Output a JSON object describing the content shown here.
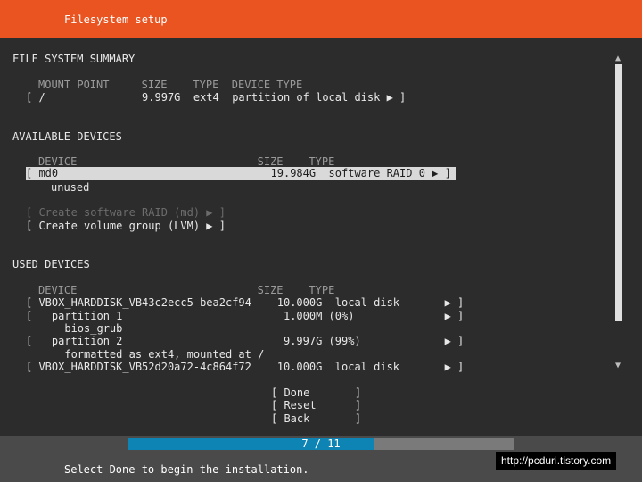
{
  "header": {
    "title": "Filesystem setup"
  },
  "summary": {
    "heading": "FILE SYSTEM SUMMARY",
    "columns": "MOUNT POINT     SIZE    TYPE  DEVICE TYPE",
    "row": "[ /               9.997G  ext4  partition of local disk ▶ ]"
  },
  "available": {
    "heading": "AVAILABLE DEVICES",
    "columns": "DEVICE                            SIZE    TYPE",
    "selected_row": "[ md0                                 19.984G  software RAID 0 ▶ ]",
    "sub": "unused",
    "create_raid": "[ Create software RAID (md) ▶ ]",
    "create_lvm": "[ Create volume group (LVM) ▶ ]"
  },
  "used": {
    "heading": "USED DEVICES",
    "columns": "DEVICE                            SIZE    TYPE",
    "rows": [
      "[ VBOX_HARDDISK_VB43c2ecc5-bea2cf94    10.000G  local disk       ▶ ]",
      "[   partition 1                         1.000M (0%)              ▶ ]",
      "      bios_grub",
      "[   partition 2                         9.997G (99%)             ▶ ]",
      "      formatted as ext4, mounted at /",
      "[ VBOX_HARDDISK_VB52d20a72-4c864f72    10.000G  local disk       ▶ ]"
    ]
  },
  "buttons": {
    "done": "[ Done       ]",
    "reset": "[ Reset      ]",
    "back": "[ Back       ]"
  },
  "scroll": {
    "up": "▲",
    "down": "▼"
  },
  "progress": {
    "label": "7 / 11",
    "current": 7,
    "total": 11
  },
  "status": "Select Done to begin the installation.",
  "watermark": "http://pcduri.tistory.com",
  "colors": {
    "accent": "#e95420",
    "background": "#2c2c2c",
    "progress": "#0e84b5",
    "selection": "#d9d9d9"
  }
}
